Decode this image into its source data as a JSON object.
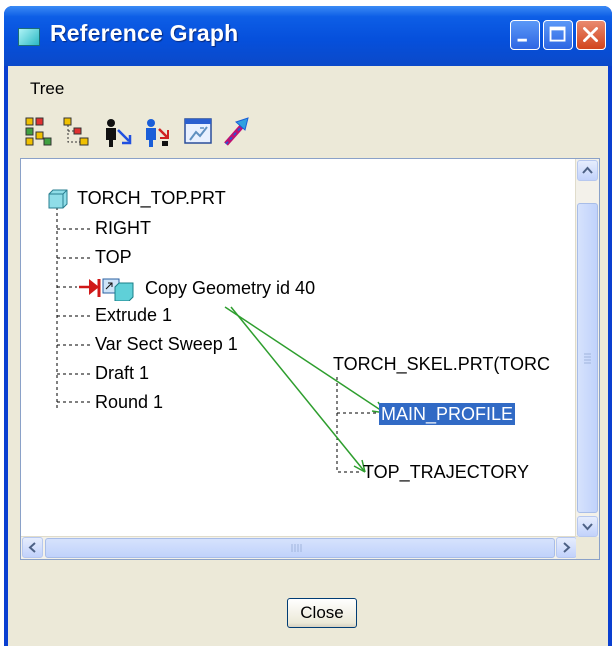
{
  "window": {
    "title": "Reference Graph",
    "icons": [
      "app-icon",
      "minimize-icon",
      "maximize-icon",
      "close-icon"
    ]
  },
  "menu": {
    "items": [
      "Tree"
    ]
  },
  "toolbar": {
    "tools": [
      "tree-view-icon",
      "graph-layout-icon",
      "show-parents-icon",
      "show-children-icon",
      "filter-icon",
      "relationship-arrow-icon"
    ]
  },
  "tree": {
    "root": {
      "label": "TORCH_TOP.PRT",
      "icon": "part-icon"
    },
    "children": [
      "RIGHT",
      "TOP",
      "Copy Geometry id 40",
      "Extrude 1",
      "Var Sect Sweep 1",
      "Draft 1",
      "Round 1"
    ],
    "external": {
      "label": "TORCH_SKEL.PRT(TORC",
      "children": [
        "MAIN_PROFILE",
        "TOP_TRAJECTORY"
      ],
      "selected": "MAIN_PROFILE"
    },
    "copy_geometry_icon": "copy-geometry-icon"
  },
  "buttons": {
    "close": "Close"
  },
  "colors": {
    "titlebar": "#0650dc",
    "selection": "#316ac5",
    "link_arrow": "#2e9e2e",
    "client": "#ece9d8"
  }
}
